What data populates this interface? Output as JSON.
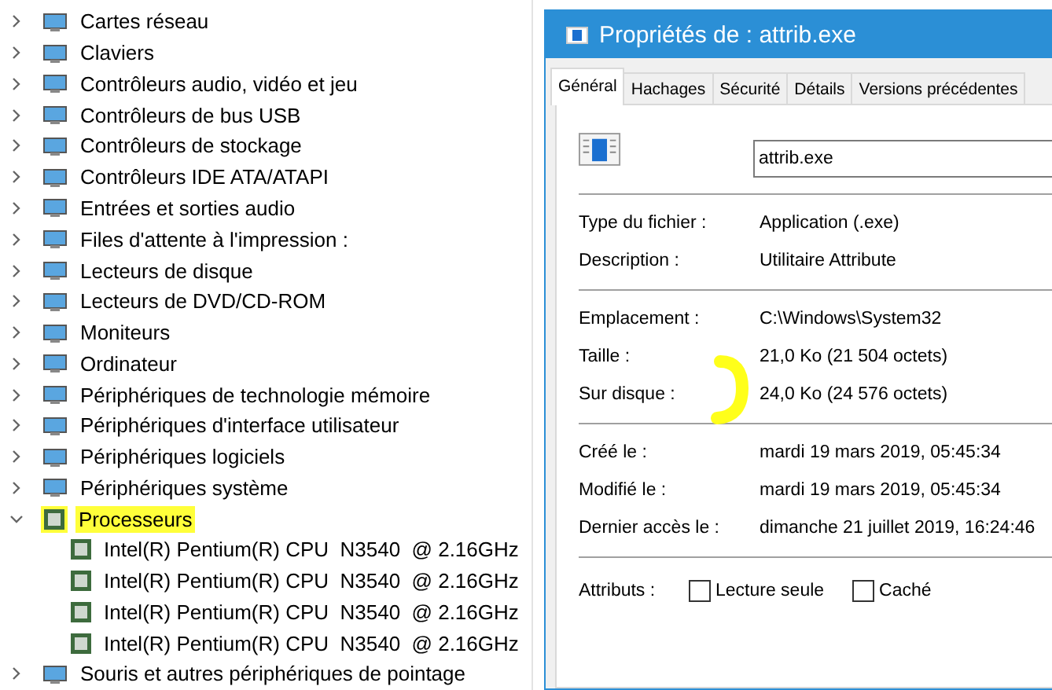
{
  "device_tree": [
    {
      "label": "Cartes réseau",
      "expanded": false,
      "highlighted": false
    },
    {
      "label": "Claviers",
      "expanded": false,
      "highlighted": false
    },
    {
      "label": "Contrôleurs audio, vidéo et jeu",
      "expanded": false,
      "highlighted": false
    },
    {
      "label": "Contrôleurs de bus USB",
      "expanded": false,
      "highlighted": false
    },
    {
      "label": "Contrôleurs de stockage",
      "expanded": false,
      "highlighted": false
    },
    {
      "label": "Contrôleurs IDE ATA/ATAPI",
      "expanded": false,
      "highlighted": false
    },
    {
      "label": "Entrées et sorties audio",
      "expanded": false,
      "highlighted": false
    },
    {
      "label": "Files d'attente à l'impression :",
      "expanded": false,
      "highlighted": false
    },
    {
      "label": "Lecteurs de disque",
      "expanded": false,
      "highlighted": false
    },
    {
      "label": "Lecteurs de DVD/CD-ROM",
      "expanded": false,
      "highlighted": false
    },
    {
      "label": "Moniteurs",
      "expanded": false,
      "highlighted": false
    },
    {
      "label": "Ordinateur",
      "expanded": false,
      "highlighted": false
    },
    {
      "label": "Périphériques de technologie mémoire",
      "expanded": false,
      "highlighted": false
    },
    {
      "label": "Périphériques d'interface utilisateur",
      "expanded": false,
      "highlighted": false
    },
    {
      "label": "Périphériques logiciels",
      "expanded": false,
      "highlighted": false
    },
    {
      "label": "Périphériques système",
      "expanded": false,
      "highlighted": false
    },
    {
      "label": "Processeurs",
      "expanded": true,
      "highlighted": true,
      "children": [
        {
          "label": "Intel(R) Pentium(R) CPU  N3540  @ 2.16GHz"
        },
        {
          "label": "Intel(R) Pentium(R) CPU  N3540  @ 2.16GHz"
        },
        {
          "label": "Intel(R) Pentium(R) CPU  N3540  @ 2.16GHz"
        },
        {
          "label": "Intel(R) Pentium(R) CPU  N3540  @ 2.16GHz"
        }
      ]
    },
    {
      "label": "Souris et autres périphériques de pointage",
      "expanded": false,
      "highlighted": false
    }
  ],
  "dialog": {
    "title": "Propriétés de : attrib.exe",
    "tabs": [
      {
        "label": "Général",
        "selected": true
      },
      {
        "label": "Hachages",
        "selected": false
      },
      {
        "label": "Sécurité",
        "selected": false
      },
      {
        "label": "Détails",
        "selected": false
      },
      {
        "label": "Versions précédentes",
        "selected": false
      }
    ],
    "file_name": "attrib.exe",
    "sections": [
      [
        {
          "label": "Type du fichier :",
          "value": "Application (.exe)"
        },
        {
          "label": "Description :",
          "value": "Utilitaire Attribute"
        }
      ],
      [
        {
          "label": "Emplacement :",
          "value": "C:\\Windows\\System32"
        },
        {
          "label": "Taille :",
          "value": "21,0 Ko (21 504 octets)"
        },
        {
          "label": "Sur disque :",
          "value": "24,0 Ko (24 576 octets)"
        }
      ],
      [
        {
          "label": "Créé le :",
          "value": "mardi 19 mars 2019, 05:45:34"
        },
        {
          "label": "Modifié le :",
          "value": "mardi 19 mars 2019, 05:45:34"
        },
        {
          "label": "Dernier accès le :",
          "value": "dimanche 21 juillet 2019, 16:24:46"
        }
      ]
    ],
    "attributes_label": "Attributs :",
    "attributes": [
      {
        "label": "Lecture seule",
        "checked": false
      },
      {
        "label": "Caché",
        "checked": false
      }
    ]
  }
}
